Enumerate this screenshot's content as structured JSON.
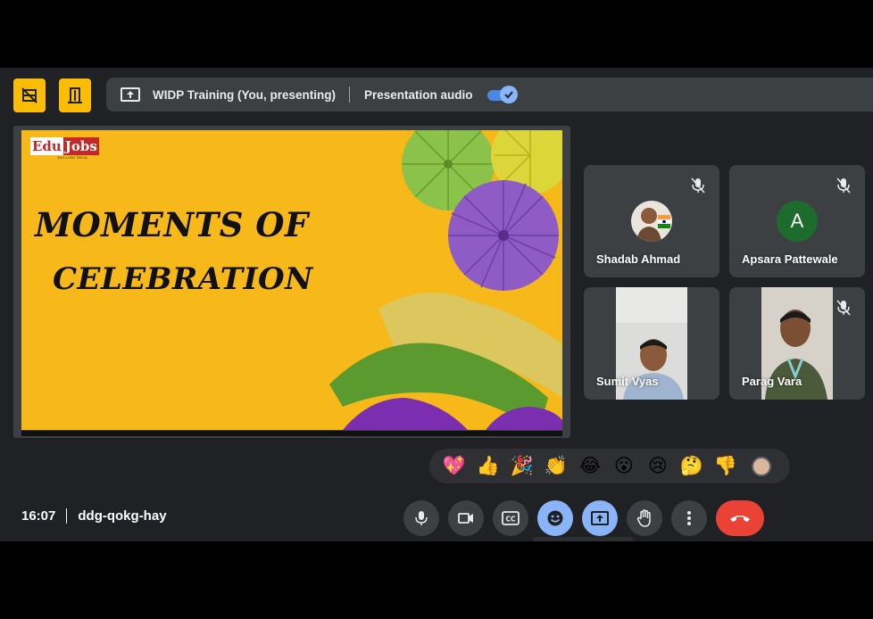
{
  "topbar": {
    "buttons": [
      {
        "icon": "hide-layout-icon"
      },
      {
        "icon": "exit-door-icon"
      }
    ],
    "presentation": {
      "icon": "present-screen-icon",
      "title": "WIDP Training (You, presenting)",
      "audio_label": "Presentation audio",
      "audio_on": true
    }
  },
  "slide": {
    "logo": {
      "edu": "Edu",
      "jobs": "Jobs",
      "tagline": "SKILLING INDIA"
    },
    "title_line1": "MOMENTS OF",
    "title_line2": "CELEBRATION",
    "background": "#f7b81a"
  },
  "participants": [
    {
      "name": "Shadab Ahmad",
      "muted": true,
      "display": "avatar-photo"
    },
    {
      "name": "Apsara Pattewale",
      "muted": true,
      "display": "avatar-letter",
      "letter": "A",
      "avatar_color": "#1e6b2e"
    },
    {
      "name": "Sumit Vyas",
      "muted": false,
      "display": "video"
    },
    {
      "name": "Parag Vara",
      "muted": true,
      "display": "video"
    }
  ],
  "reactions": [
    "💖",
    "👍",
    "🎉",
    "👏",
    "😂",
    "😮",
    "😢",
    "🤔",
    "👎"
  ],
  "meeting": {
    "time": "16:07",
    "code": "ddg-qokg-hay"
  },
  "controls": [
    {
      "icon": "microphone-icon"
    },
    {
      "icon": "camera-icon"
    },
    {
      "icon": "captions-icon"
    },
    {
      "icon": "emoji-icon",
      "active": true
    },
    {
      "icon": "present-screen-icon",
      "active": true
    },
    {
      "icon": "raise-hand-icon"
    },
    {
      "icon": "more-options-icon"
    },
    {
      "icon": "end-call-icon"
    }
  ],
  "colors": {
    "accent": "#8ab4f8",
    "end_call": "#ea4335",
    "highlight": "#fbbc04",
    "background": "#202124",
    "tile": "#3c4043"
  }
}
